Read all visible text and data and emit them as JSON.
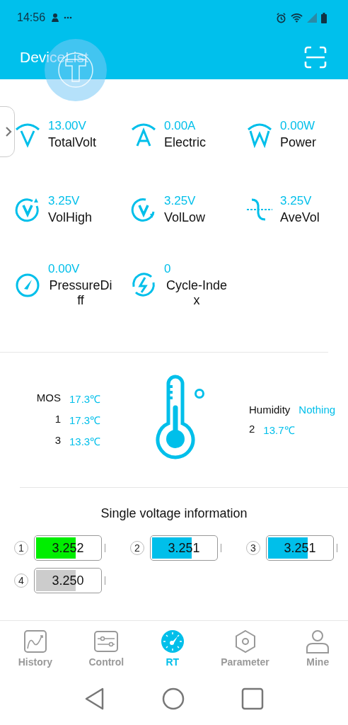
{
  "status_bar": {
    "time": "14:56"
  },
  "header": {
    "title": "DeviceList"
  },
  "metrics": [
    {
      "value": "13.00V",
      "label": "TotalVolt",
      "kind": "volt"
    },
    {
      "value": "0.00A",
      "label": "Electric",
      "kind": "amp"
    },
    {
      "value": "0.00W",
      "label": "Power",
      "kind": "watt"
    },
    {
      "value": "3.25V",
      "label": "VolHigh",
      "kind": "high"
    },
    {
      "value": "3.25V",
      "label": "VolLow",
      "kind": "low"
    },
    {
      "value": "3.25V",
      "label": "AveVol",
      "kind": "ave"
    },
    {
      "value": "0.00V",
      "label": "PressureDiff",
      "kind": "gauge"
    },
    {
      "value": "0",
      "label": "Cycle-Index",
      "kind": "cycle"
    }
  ],
  "temperatures": [
    {
      "label": "MOS",
      "value": "17.3℃"
    },
    {
      "label": "1",
      "value": "17.3℃"
    },
    {
      "label": "3",
      "value": "13.3℃"
    }
  ],
  "humidity": {
    "label": "Humidity",
    "value": "Nothing"
  },
  "temperatures_right": [
    {
      "label": "2",
      "value": "13.7℃"
    }
  ],
  "cells_section": {
    "title": "Single voltage information",
    "cells": [
      {
        "index": "1",
        "value": "3.252",
        "level": 0.6,
        "color": "#00ee00"
      },
      {
        "index": "2",
        "value": "3.251",
        "level": 0.6,
        "color": "#00bfea"
      },
      {
        "index": "3",
        "value": "3.251",
        "level": 0.6,
        "color": "#00bfea"
      },
      {
        "index": "4",
        "value": "3.250",
        "level": 0.6,
        "color": "#cccccc"
      }
    ]
  },
  "tabs": [
    {
      "label": "History",
      "kind": "chart",
      "selected": false
    },
    {
      "label": "Control",
      "kind": "sliders",
      "selected": false
    },
    {
      "label": "RT",
      "kind": "dial",
      "selected": true
    },
    {
      "label": "Parameter",
      "kind": "hex",
      "selected": false
    },
    {
      "label": "Mine",
      "kind": "person",
      "selected": false
    }
  ]
}
